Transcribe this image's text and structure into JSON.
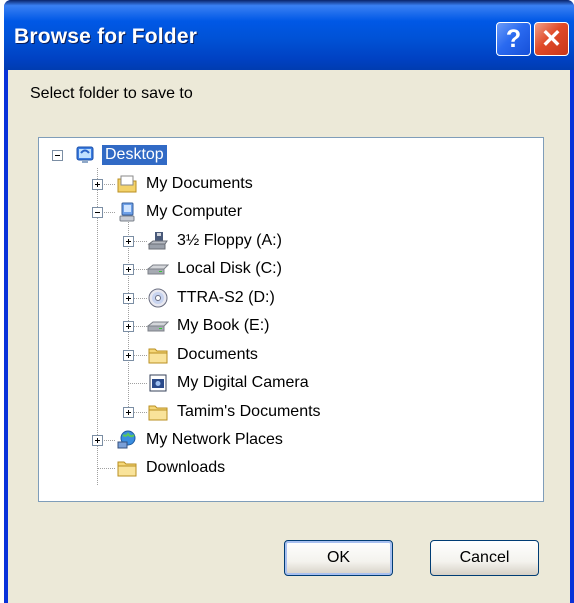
{
  "window": {
    "title": "Browse for Folder",
    "help_label": "?",
    "close_label": "✕"
  },
  "prompt": "Select folder to save to",
  "tree": {
    "items": [
      {
        "label": "Desktop",
        "icon": "desktop-icon",
        "expanded": true,
        "selected": true
      },
      {
        "label": "My Documents",
        "icon": "my-documents-icon",
        "expanded": false
      },
      {
        "label": "My Computer",
        "icon": "my-computer-icon",
        "expanded": true
      },
      {
        "label": "3½ Floppy (A:)",
        "icon": "floppy-drive-icon",
        "expanded": false
      },
      {
        "label": "Local Disk (C:)",
        "icon": "hard-disk-icon",
        "expanded": false
      },
      {
        "label": "TTRA-S2 (D:)",
        "icon": "cd-drive-icon",
        "expanded": false
      },
      {
        "label": "My Book (E:)",
        "icon": "hard-disk-icon",
        "expanded": false
      },
      {
        "label": "Documents",
        "icon": "folder-icon",
        "expanded": false
      },
      {
        "label": "My Digital Camera",
        "icon": "camera-icon"
      },
      {
        "label": "Tamim's Documents",
        "icon": "folder-icon",
        "expanded": false
      },
      {
        "label": "My Network Places",
        "icon": "network-places-icon",
        "expanded": false
      },
      {
        "label": "Downloads",
        "icon": "folder-icon"
      }
    ]
  },
  "buttons": {
    "ok": "OK",
    "cancel": "Cancel"
  },
  "colors": {
    "title_bar": "#0058e6",
    "selection": "#316ac5",
    "dialog_bg": "#ece9d8",
    "close_button": "#e04a28"
  }
}
